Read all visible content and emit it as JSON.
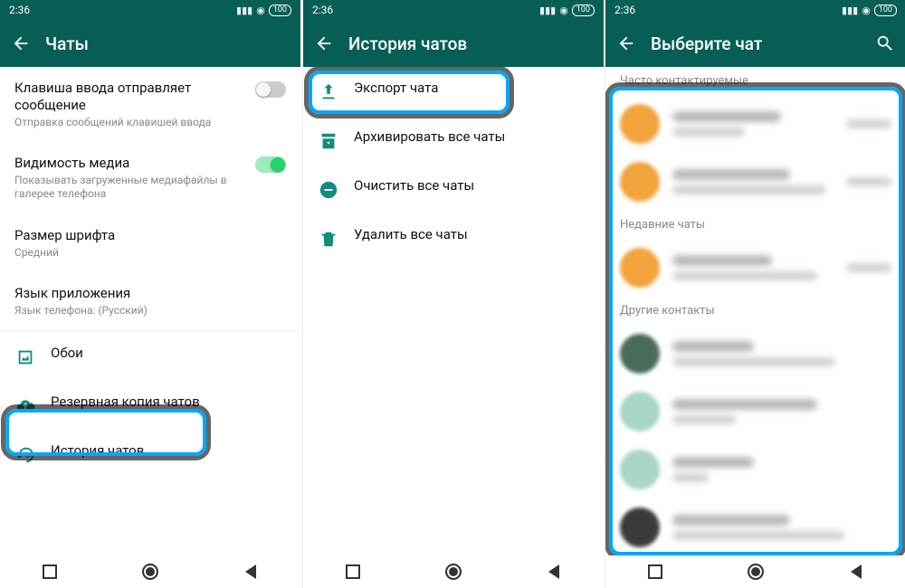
{
  "status": {
    "time": "2:36",
    "battery": "100"
  },
  "screen1": {
    "title": "Чаты",
    "rows": {
      "enterSend": {
        "title": "Клавиша ввода отправляет сообщение",
        "sub": "Отправка сообщений клавишей ввода"
      },
      "mediaVis": {
        "title": "Видимость медиа",
        "sub": "Показывать загруженные медиафайлы в галерее телефона"
      },
      "fontSize": {
        "title": "Размер шрифта",
        "sub": "Средний"
      },
      "appLang": {
        "title": "Язык приложения",
        "sub": "Язык телефона: (Русский)"
      },
      "wallpaper": "Обои",
      "backup": "Резервная копия чатов",
      "history": "История чатов"
    }
  },
  "screen2": {
    "title": "История чатов",
    "rows": {
      "export": "Экспорт чата",
      "archive": "Архивировать все чаты",
      "clear": "Очистить все чаты",
      "delete": "Удалить все чаты"
    }
  },
  "screen3": {
    "title": "Выберите чат",
    "sections": {
      "frequent": "Часто контактируемые",
      "recent": "Недавние чаты",
      "other": "Другие контакты"
    }
  }
}
